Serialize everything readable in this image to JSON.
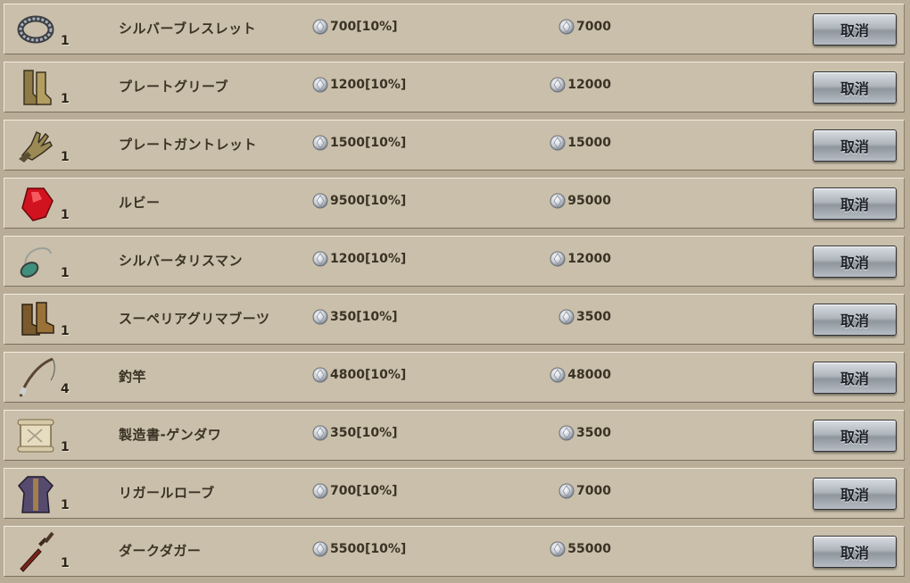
{
  "ui": {
    "cancel_label": "取消",
    "row_bg": "#c9bfaa",
    "page_bg": "#b9ad98"
  },
  "items": [
    {
      "name": "シルバーブレスレット",
      "qty": "1",
      "price": "700[10%]",
      "total": "7000",
      "icon": "bracelet-icon"
    },
    {
      "name": "プレートグリーブ",
      "qty": "1",
      "price": "1200[10%]",
      "total": "12000",
      "icon": "greaves-icon"
    },
    {
      "name": "プレートガントレット",
      "qty": "1",
      "price": "1500[10%]",
      "total": "15000",
      "icon": "gauntlet-icon"
    },
    {
      "name": "ルビー",
      "qty": "1",
      "price": "9500[10%]",
      "total": "95000",
      "icon": "ruby-icon"
    },
    {
      "name": "シルバータリスマン",
      "qty": "1",
      "price": "1200[10%]",
      "total": "12000",
      "icon": "talisman-icon"
    },
    {
      "name": "スーペリアグリマブーツ",
      "qty": "1",
      "price": "350[10%]",
      "total": "3500",
      "icon": "boots-icon"
    },
    {
      "name": "釣竿",
      "qty": "4",
      "price": "4800[10%]",
      "total": "48000",
      "icon": "fishing-rod-icon"
    },
    {
      "name": "製造書-ゲンダワ",
      "qty": "1",
      "price": "350[10%]",
      "total": "3500",
      "icon": "scroll-icon"
    },
    {
      "name": "リガールローブ",
      "qty": "1",
      "price": "700[10%]",
      "total": "7000",
      "icon": "robe-icon"
    },
    {
      "name": "ダークダガー",
      "qty": "1",
      "price": "5500[10%]",
      "total": "55000",
      "icon": "dagger-icon"
    }
  ]
}
